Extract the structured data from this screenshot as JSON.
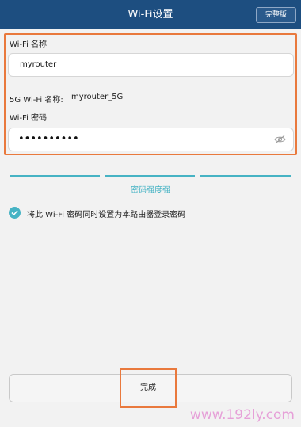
{
  "header": {
    "title": "Wi-Fi设置",
    "right_button": "完整版"
  },
  "form": {
    "wifi_name_label": "Wi-Fi 名称",
    "wifi_name_value": "myrouter",
    "wifi_5g_label": "5G Wi-Fi 名称:",
    "wifi_5g_value": "myrouter_5G",
    "wifi_password_label": "Wi-Fi 密码",
    "wifi_password_mask": "••••••••••",
    "eye_icon": "eye-hidden-icon"
  },
  "strength": {
    "label": "密码强度强",
    "color": "#46b3c4",
    "level": 3,
    "max_level": 3
  },
  "option": {
    "checked": true,
    "label": "将此 Wi-Fi 密码同时设置为本路由器登录密码"
  },
  "footer": {
    "done_label": "完成"
  },
  "watermark": "www.192ly.com",
  "colors": {
    "header_bg": "#1d4e80",
    "highlight": "#e9793d",
    "accent": "#46b3c4"
  }
}
